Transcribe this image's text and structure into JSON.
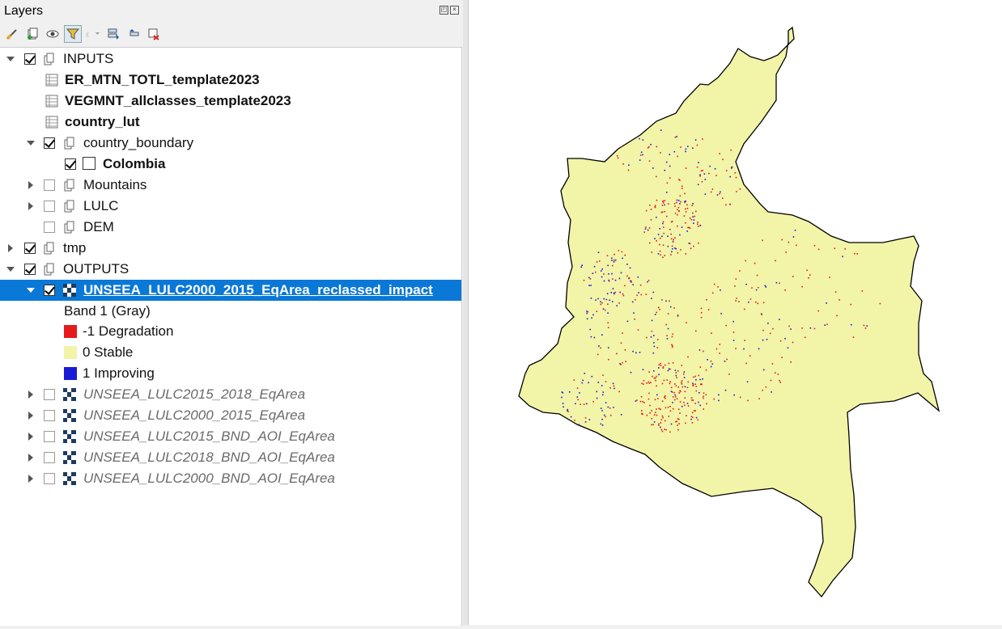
{
  "panel": {
    "title": "Layers"
  },
  "toolbar": {
    "buttons": [
      {
        "name": "style-layer-icon"
      },
      {
        "name": "add-group-icon"
      },
      {
        "name": "manage-visibility-icon"
      },
      {
        "name": "filter-legend-icon",
        "active": true
      },
      {
        "name": "filter-expression-icon",
        "disabled": true
      },
      {
        "name": "expand-all-icon"
      },
      {
        "name": "collapse-all-icon"
      },
      {
        "name": "remove-layer-icon"
      }
    ]
  },
  "tree": {
    "inputs_group": "INPUTS",
    "tables": [
      "ER_MTN_TOTL_template2023",
      "VEGMNT_allclasses_template2023",
      "country_lut"
    ],
    "country_boundary": "country_boundary",
    "colombia": "Colombia",
    "mountains": "Mountains",
    "lulc": "LULC",
    "dem": "DEM",
    "tmp": "tmp",
    "outputs_group": "OUTPUTS",
    "impact_layer": "UNSEEA_LULC2000_2015_EqArea_reclassed_impact",
    "band": "Band 1 (Gray)",
    "legend": [
      {
        "label": "-1 Degradation",
        "color": "#e41a1c"
      },
      {
        "label": "0 Stable",
        "color": "#f2f4a8"
      },
      {
        "label": "1 Improving",
        "color": "#1a1ad6"
      }
    ],
    "rasters": [
      "UNSEEA_LULC2015_2018_EqArea",
      "UNSEEA_LULC2000_2015_EqArea",
      "UNSEEA_LULC2015_BND_AOI_EqArea",
      "UNSEEA_LULC2018_BND_AOI_EqArea",
      "UNSEEA_LULC2000_BND_AOI_EqArea"
    ]
  },
  "colors": {
    "selection": "#0a78d7",
    "stable": "#f2f4a8",
    "degradation": "#e41a1c",
    "improving": "#1a1ad6"
  }
}
